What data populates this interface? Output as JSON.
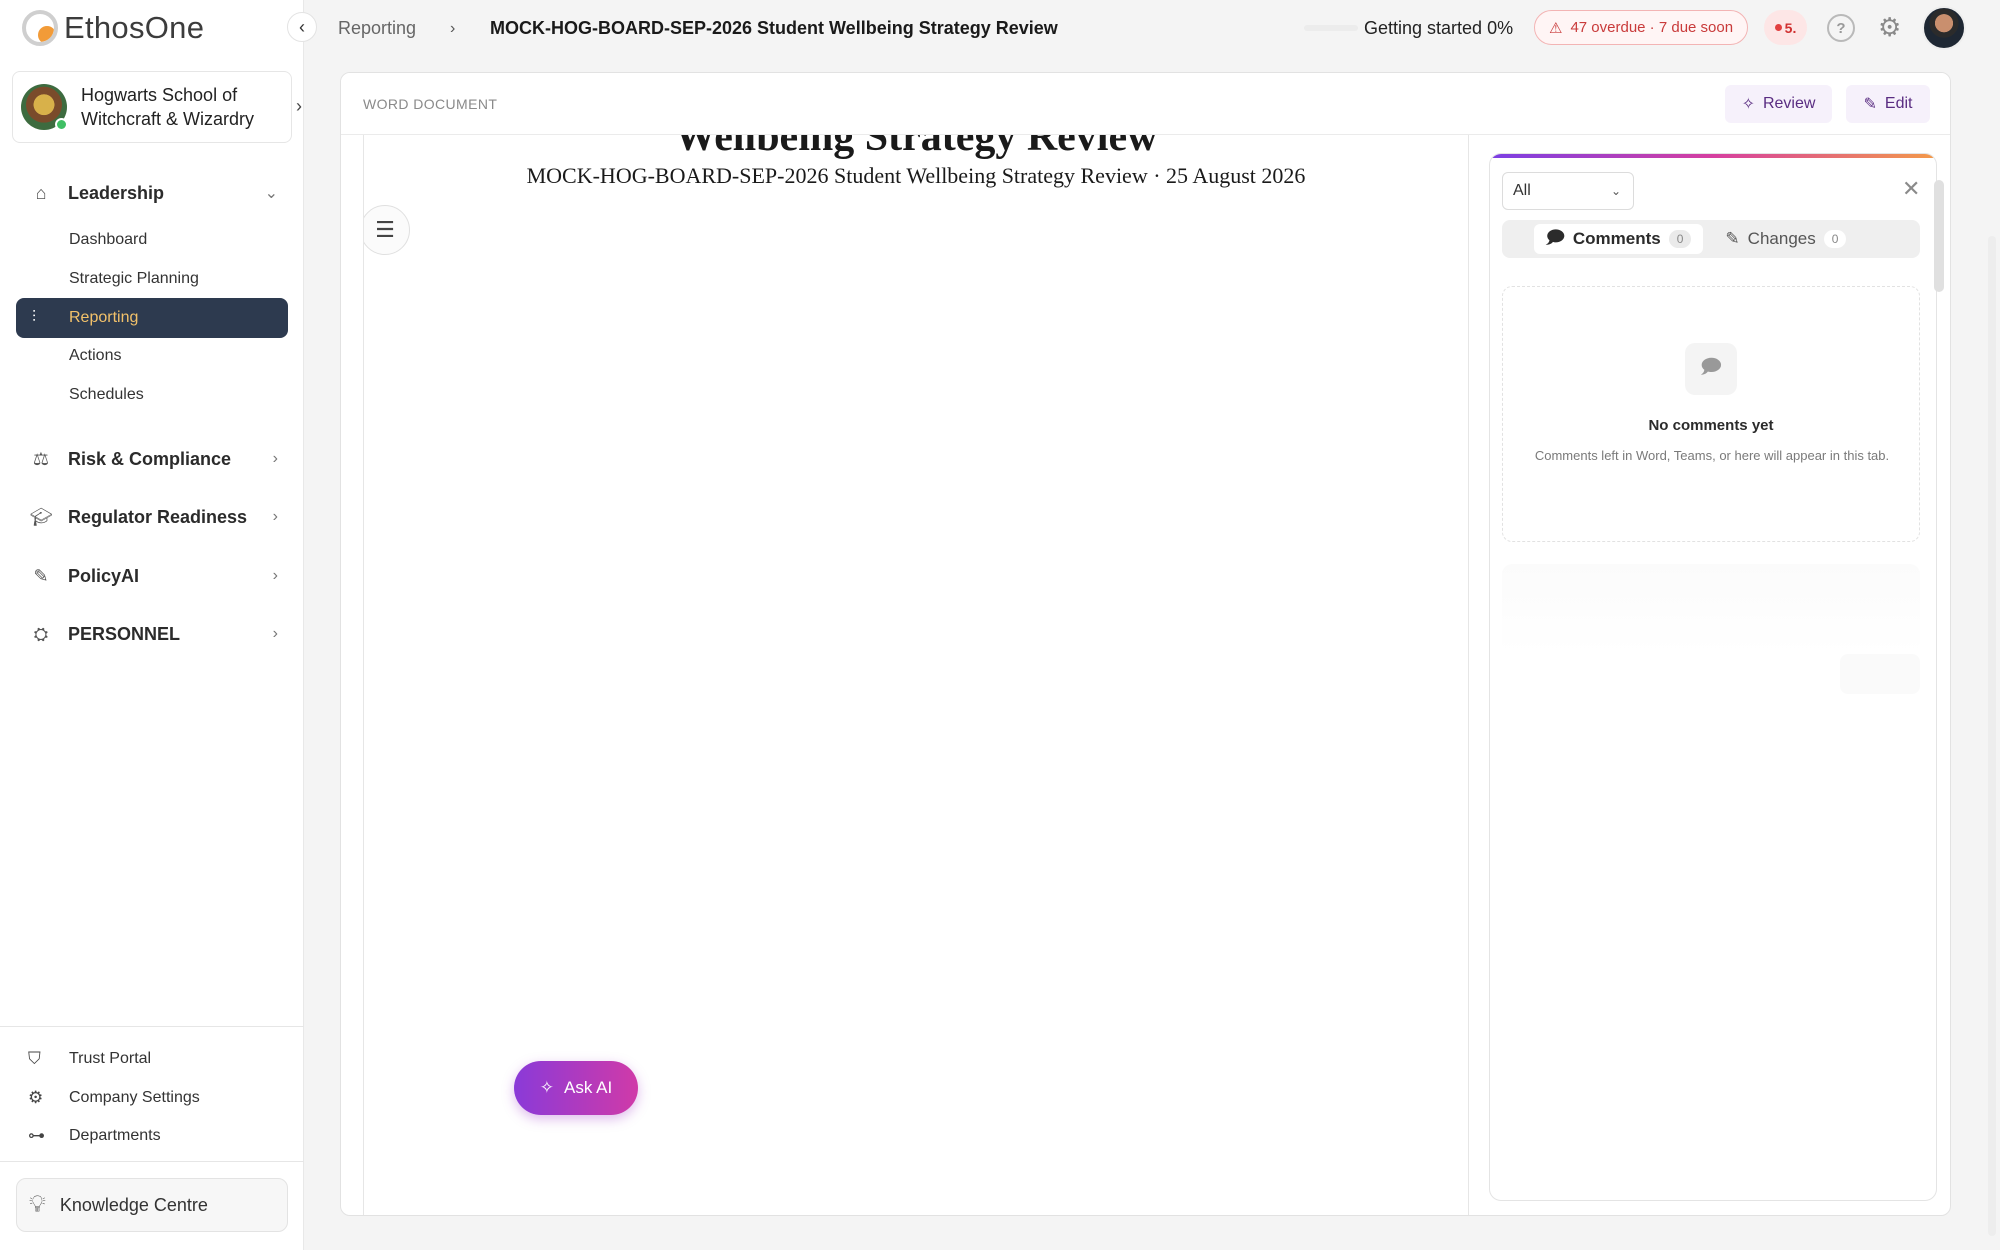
{
  "app": {
    "logo_text": "EthosOne"
  },
  "sidebar": {
    "org_name": "Hogwarts School of Witchcraft & Wizardry",
    "sections": [
      {
        "label": "Leadership",
        "icon": "home-icon",
        "expanded": true,
        "items": [
          "Dashboard",
          "Strategic Planning",
          "Reporting",
          "Actions",
          "Schedules"
        ],
        "active_item": "Reporting"
      },
      {
        "label": "Risk & Compliance",
        "icon": "scales-icon"
      },
      {
        "label": "Regulator Readiness",
        "icon": "graduation-cap-icon"
      },
      {
        "label": "PolicyAI",
        "icon": "pen-icon"
      },
      {
        "label": "PERSONNEL",
        "icon": "people-icon"
      }
    ],
    "bottom_items": [
      {
        "label": "Trust Portal",
        "icon": "shield-icon"
      },
      {
        "label": "Company Settings",
        "icon": "gear-icon"
      },
      {
        "label": "Departments",
        "icon": "org-chart-icon"
      }
    ],
    "knowledge_centre": "Knowledge Centre"
  },
  "topbar": {
    "breadcrumb_parent": "Reporting",
    "breadcrumb_current": "MOCK-HOG-BOARD-SEP-2026 Student Wellbeing Strategy Review",
    "getting_started": "Getting started 0%",
    "getting_started_progress": 0,
    "overdue_text": "47 overdue · 7 due soon",
    "notification_count": "5."
  },
  "document": {
    "type_label": "WORD DOCUMENT",
    "review_label": "Review",
    "edit_label": "Edit",
    "title_fragment": "Wellbeing Strategy Review",
    "subtitle": "MOCK-HOG-BOARD-SEP-2026 Student Wellbeing Strategy Review · 25 August 2026",
    "ask_ai_label": "Ask AI"
  },
  "comments_panel": {
    "filter_value": "All",
    "tabs": [
      {
        "label": "Comments",
        "count": "0"
      },
      {
        "label": "Changes",
        "count": "0"
      }
    ],
    "active_tab": "Comments",
    "empty_title": "No comments yet",
    "empty_description": "Comments left in Word, Teams, or here will appear in this tab."
  },
  "colors": {
    "accent_orange": "#f29b38",
    "nav_active_bg": "#2d3a4f",
    "nav_active_text": "#f2c16a",
    "ai_gradient_start": "#8a3ad8",
    "ai_gradient_end": "#d03aa8",
    "overdue_red": "#c93a3a"
  }
}
